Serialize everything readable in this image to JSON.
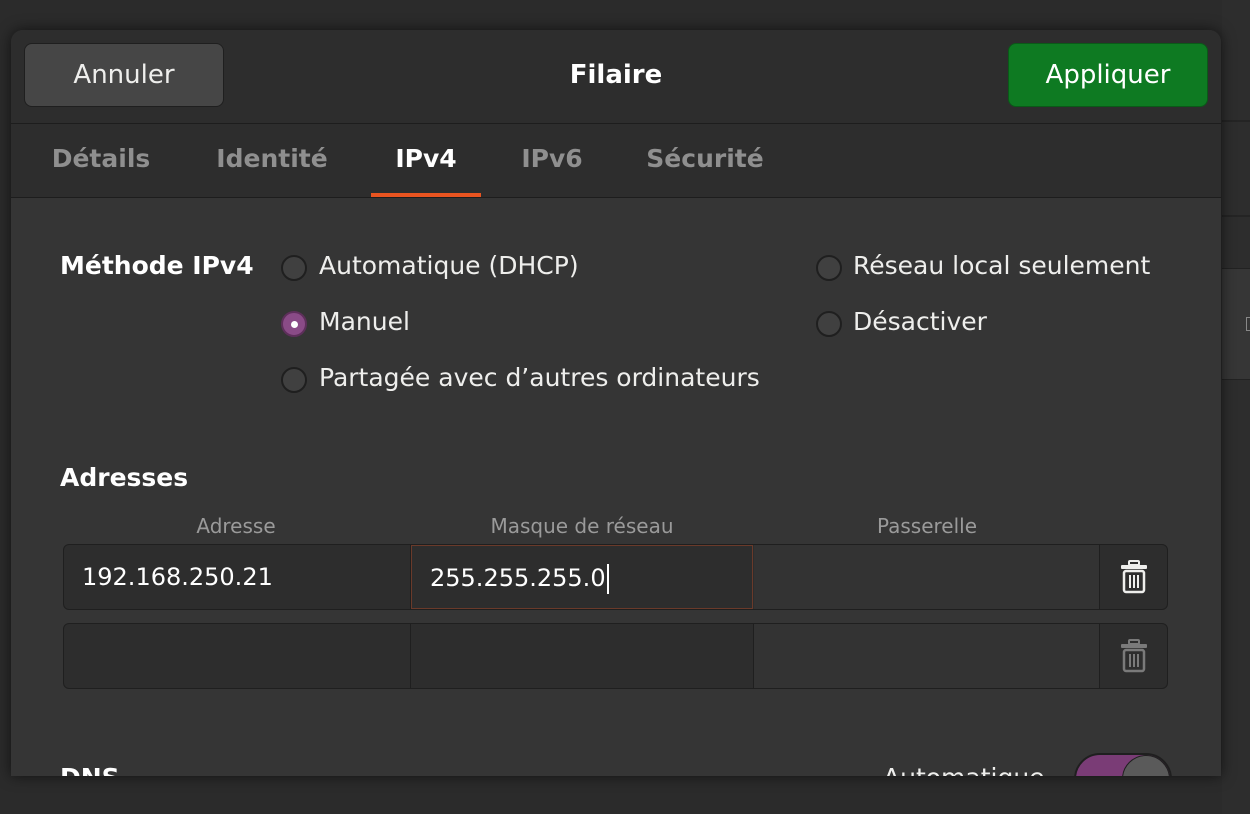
{
  "header": {
    "cancel_label": "Annuler",
    "title": "Filaire",
    "apply_label": "Appliquer"
  },
  "tabs": [
    {
      "label": "Détails",
      "active": false
    },
    {
      "label": "Identité",
      "active": false
    },
    {
      "label": "IPv4",
      "active": true
    },
    {
      "label": "IPv6",
      "active": false
    },
    {
      "label": "Sécurité",
      "active": false
    }
  ],
  "method": {
    "label": "Méthode IPv4",
    "options": [
      {
        "label": "Automatique (DHCP)",
        "checked": false
      },
      {
        "label": "Manuel",
        "checked": true
      },
      {
        "label": "Partagée avec d’autres ordinateurs",
        "checked": false
      },
      {
        "label": "Réseau local seulement",
        "checked": false
      },
      {
        "label": "Désactiver",
        "checked": false
      }
    ]
  },
  "addresses": {
    "label": "Adresses",
    "columns": [
      "Adresse",
      "Masque de réseau",
      "Passerelle"
    ],
    "rows": [
      {
        "address": "192.168.250.21",
        "netmask": "255.255.255.0",
        "gateway": ""
      },
      {
        "address": "",
        "netmask": "",
        "gateway": ""
      }
    ]
  },
  "dns": {
    "label": "DNS",
    "auto_label": "Automatique",
    "auto_enabled": true
  },
  "colors": {
    "apply_green": "#0e7a22",
    "tab_underline": "#e95420",
    "accent_purple": "#8a4b87"
  }
}
